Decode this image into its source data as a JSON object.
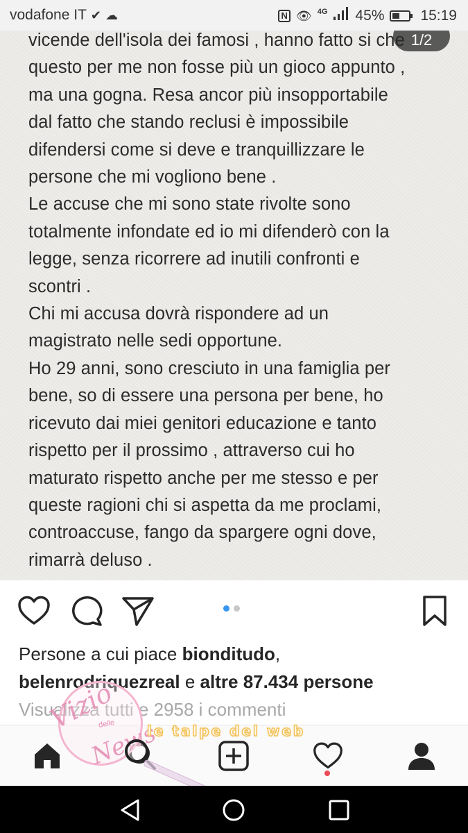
{
  "status_bar": {
    "carrier": "vodafone IT",
    "network": "4G",
    "battery": "45%",
    "battery_level": 0.45,
    "time": "15:19",
    "icons": [
      "check-icon",
      "cloud-icon",
      "nfc-icon",
      "eye-icon",
      "signal-icon",
      "battery-icon"
    ]
  },
  "post": {
    "counter": "1/2",
    "text_lines": [
      "vicende dell'isola dei famosi , hanno fatto si che",
      "questo per me non fosse più un gioco appunto ,",
      "ma una gogna.  Resa ancor più insopportabile",
      "dal fatto che stando reclusi è impossibile",
      "difendersi come si deve e tranquillizzare le",
      "persone che mi vogliono bene .",
      "Le accuse che mi sono state rivolte sono",
      "totalmente infondate ed io mi difenderò con la",
      "legge, senza ricorrere ad inutili confronti e",
      "scontri .",
      "Chi mi accusa dovrà rispondere ad un",
      "magistrato nelle sedi opportune.",
      "Ho 29 anni, sono cresciuto in una famiglia per",
      "bene, so di essere una persona per bene, ho",
      "ricevuto dai miei genitori educazione e tanto",
      "rispetto per il prossimo , attraverso cui ho",
      "maturato rispetto anche per me stesso e per",
      "queste ragioni chi si aspetta da me proclami,",
      "controaccuse, fango da spargere ogni dove,",
      "rimarrà deluso ."
    ],
    "carousel": {
      "total": 2,
      "active": 0
    }
  },
  "likes": {
    "prefix": "Persone a cui piace ",
    "user1": "bionditudo",
    "comma": ",",
    "user2": "belenrodriquezreal",
    "middle": " e ",
    "others": "altre 87.434 persone"
  },
  "comments_link": "Visualizza tutti e 2958 i commenti",
  "watermark": {
    "script_top": "Vizio",
    "script_small": "delle",
    "script_bottom": "News",
    "bubble_text": "le talpe del web"
  },
  "colors": {
    "accent_blue": "#3897f0",
    "notification_red": "#ed4956",
    "muted_text": "#a8a8a8"
  }
}
